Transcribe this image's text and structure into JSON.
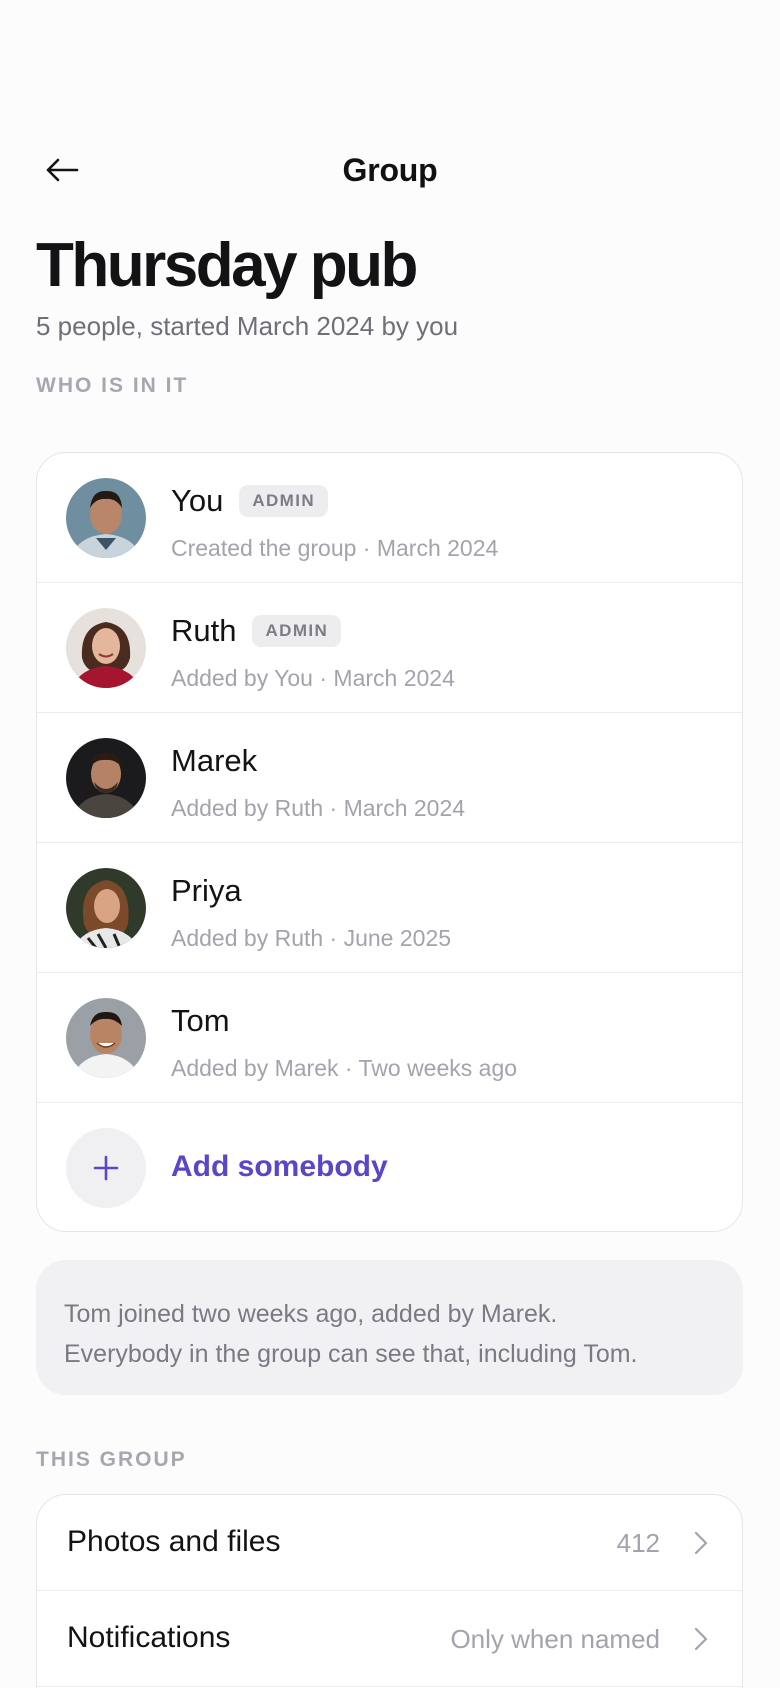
{
  "header": {
    "title": "Group",
    "back_icon": "arrow-left-icon"
  },
  "group": {
    "name": "Thursday pub",
    "summary": "5 people, started March 2024 by you"
  },
  "members_section": {
    "label": "WHO IS IN IT"
  },
  "members": [
    {
      "name": "You",
      "badge": "ADMIN",
      "meta": "Created the group · March 2024"
    },
    {
      "name": "Ruth",
      "badge": "ADMIN",
      "meta": "Added by You · March 2024"
    },
    {
      "name": "Marek",
      "meta": "Added by Ruth · March 2024"
    },
    {
      "name": "Priya",
      "meta": "Added by Ruth · June 2025"
    },
    {
      "name": "Tom",
      "meta": "Added by Marek · Two weeks ago"
    }
  ],
  "add_member": {
    "label": "Add somebody",
    "icon": "plus-icon"
  },
  "notice": {
    "line1": "Tom joined two weeks ago, added by Marek.",
    "line2": "Everybody in the group can see that, including Tom."
  },
  "group_section": {
    "label": "THIS GROUP"
  },
  "settings": [
    {
      "label": "Photos and files",
      "value": "412"
    },
    {
      "label": "Notifications",
      "value": "Only when named"
    }
  ],
  "colors": {
    "accent": "#5b46c8",
    "muted": "#a3a3ad",
    "badge_bg": "#ededf0"
  }
}
